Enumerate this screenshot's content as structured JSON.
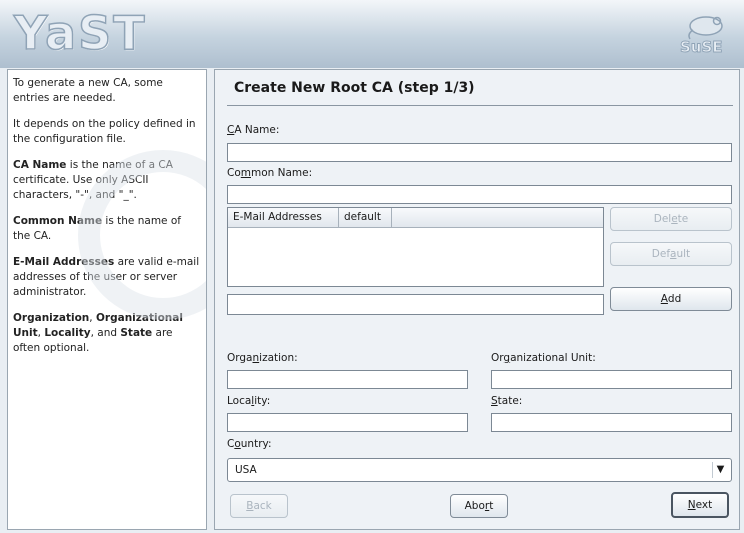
{
  "app": {
    "logo_text": "YaST",
    "brand_text": "SuSE"
  },
  "help": {
    "p1": "To generate a new CA, some entries are needed.",
    "p2": "It depends on the policy defined in the configuration file.",
    "p3_bold": "CA Name",
    "p3_rest": " is the name of a CA certificate. Use only ASCII characters, \"-\", and \"_\".",
    "p4_bold": "Common Name",
    "p4_rest": " is the name of the CA.",
    "p5_bold": "E-Mail Addresses",
    "p5_rest": " are valid e-mail addresses of the user or server administrator.",
    "p6_b1": "Organization",
    "p6_t1": ", ",
    "p6_b2": "Organizational Unit",
    "p6_t2": ", ",
    "p6_b3": "Locality",
    "p6_t3": ", and ",
    "p6_b4": "State",
    "p6_t4": " are often optional."
  },
  "dialog": {
    "title": "Create New Root CA (step 1/3)",
    "ca_name": {
      "label_u": "C",
      "label_rest": "A Name:",
      "value": ""
    },
    "common_name": {
      "label_pre": "Co",
      "label_u": "m",
      "label_rest": "mon Name:",
      "value": ""
    },
    "email_table": {
      "columns": [
        "E-Mail Addresses",
        "default"
      ],
      "rows": []
    },
    "email_input": {
      "value": ""
    },
    "buttons": {
      "delete_pre": "Del",
      "delete_u": "e",
      "delete_rest": "te",
      "default_pre": "Def",
      "default_u": "a",
      "default_rest": "ult",
      "add_u": "A",
      "add_rest": "dd"
    },
    "organization": {
      "label_pre": "Orga",
      "label_u": "n",
      "label_rest": "ization:",
      "value": ""
    },
    "org_unit": {
      "label_pre": "Or",
      "label_u": "g",
      "label_rest": "anizational Unit:",
      "value": ""
    },
    "locality": {
      "label_pre": "Loca",
      "label_u": "l",
      "label_rest": "ity:",
      "value": ""
    },
    "state": {
      "label_u": "S",
      "label_rest": "tate:",
      "value": ""
    },
    "country": {
      "label_pre": "C",
      "label_u": "o",
      "label_rest": "untry:",
      "selected": "USA"
    },
    "footer": {
      "back_u": "B",
      "back_rest": "ack",
      "abort_pre": "Abo",
      "abort_u": "r",
      "abort_rest": "t",
      "next_u": "N",
      "next_rest": "ext"
    }
  }
}
